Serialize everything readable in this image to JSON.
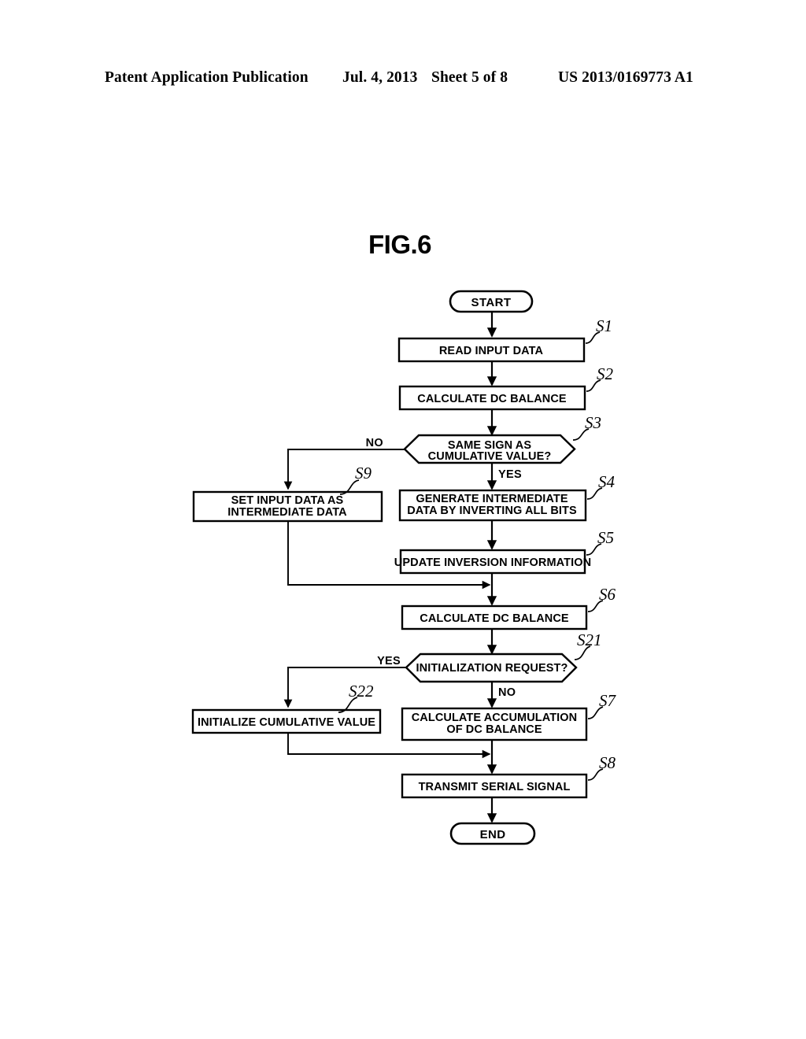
{
  "header": {
    "publication": "Patent Application Publication",
    "date": "Jul. 4, 2013",
    "sheet": "Sheet 5 of 8",
    "patent_number": "US 2013/0169773 A1"
  },
  "figure": {
    "title": "FIG.6"
  },
  "flowchart": {
    "start_label": "START",
    "end_label": "END",
    "nodes": {
      "s1": {
        "step": "S1",
        "text": "READ INPUT DATA"
      },
      "s2": {
        "step": "S2",
        "text": "CALCULATE DC BALANCE"
      },
      "s3": {
        "step": "S3",
        "line1": "SAME SIGN AS",
        "line2": "CUMULATIVE VALUE?"
      },
      "s9": {
        "step": "S9",
        "line1": "SET INPUT DATA AS",
        "line2": "INTERMEDIATE DATA"
      },
      "s4": {
        "step": "S4",
        "line1": "GENERATE INTERMEDIATE",
        "line2": "DATA BY INVERTING ALL BITS"
      },
      "s5": {
        "step": "S5",
        "text": "UPDATE INVERSION INFORMATION"
      },
      "s6": {
        "step": "S6",
        "text": "CALCULATE DC BALANCE"
      },
      "s21": {
        "step": "S21",
        "text": "INITIALIZATION REQUEST?"
      },
      "s22": {
        "step": "S22",
        "text": "INITIALIZE CUMULATIVE VALUE"
      },
      "s7": {
        "step": "S7",
        "line1": "CALCULATE ACCUMULATION",
        "line2": "OF DC BALANCE"
      },
      "s8": {
        "step": "S8",
        "text": "TRANSMIT SERIAL SIGNAL"
      }
    },
    "branches": {
      "s3_no": "NO",
      "s3_yes": "YES",
      "s21_yes": "YES",
      "s21_no": "NO"
    }
  },
  "colors": {
    "ink": "#000000",
    "paper": "#ffffff"
  }
}
